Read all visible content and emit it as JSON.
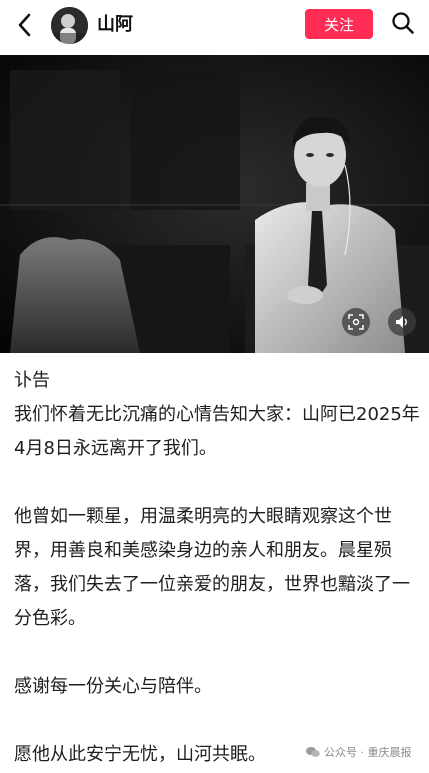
{
  "header": {
    "username": "山阿",
    "follow_label": "关注",
    "icons": [
      "back-arrow-icon",
      "avatar",
      "search-icon"
    ],
    "follow_color": "#ff2d55"
  },
  "media": {
    "type": "video",
    "icons": [
      "scan-icon",
      "sound-icon"
    ]
  },
  "article": {
    "title": "讣告",
    "para1": "我们怀着无比沉痛的心情告知大家：山阿已2025年4月8日永远离开了我们。",
    "para2": "他曾如一颗星，用温柔明亮的大眼睛观察这个世界，用善良和美感染身边的亲人和朋友。晨星殒落，我们失去了一位亲爱的朋友，世界也黯淡了一分色彩。",
    "para3": "感谢每一份关心与陪伴。",
    "para4": "愿他从此安宁无忧，山河共眠。"
  },
  "watermark": {
    "text": "公众号 · 重庆晨报"
  }
}
